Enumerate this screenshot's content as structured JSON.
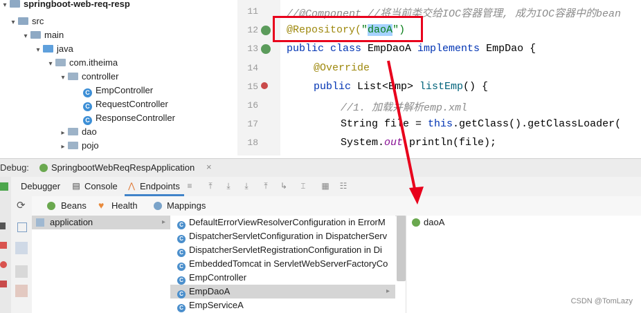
{
  "project_tree": {
    "root": "springboot-web-req-resp",
    "items": [
      {
        "label": "src"
      },
      {
        "label": "main"
      },
      {
        "label": "java"
      },
      {
        "label": "com.itheima"
      },
      {
        "label": "controller"
      },
      {
        "label": "EmpController"
      },
      {
        "label": "RequestController"
      },
      {
        "label": "ResponseController"
      },
      {
        "label": "dao"
      },
      {
        "label": "pojo"
      }
    ]
  },
  "editor": {
    "line_numbers": [
      "11",
      "12",
      "13",
      "14",
      "15",
      "16",
      "17",
      "18"
    ],
    "lines": {
      "l11": "//@Component //将当前类交给IOC容器管理, 成为IOC容器中的bean",
      "l12_ann": "@Repository(",
      "l12_q1": "\"",
      "l12_sel": "daoA",
      "l12_q2": "\")",
      "l13_kw1": "public class ",
      "l13_name": "EmpDaoA ",
      "l13_kw2": "implements ",
      "l13_iface": "EmpDao {",
      "l14": "@Override",
      "l15_kw": "public ",
      "l15_type": "List<Emp> ",
      "l15_fn": "listEmp",
      "l15_rest": "() {",
      "l16": "//1. 加载并解析emp.xml",
      "l17_a": "String file = ",
      "l17_kw": "this",
      "l17_b": ".getClass().getClassLoader(",
      "l18_a": "System.",
      "l18_fld": "out",
      "l18_b": ".println(file);"
    }
  },
  "debug": {
    "label": "Debug:",
    "session_tab": "SpringbootWebReqRespApplication",
    "close": "×",
    "tabs": [
      "Debugger",
      "Console",
      "Endpoints"
    ],
    "subtabs": [
      "Beans",
      "Health",
      "Mappings"
    ]
  },
  "beans": {
    "context": "application",
    "list": [
      "DefaultErrorViewResolverConfiguration in ErrorM",
      "DispatcherServletConfiguration in DispatcherServ",
      "DispatcherServletRegistrationConfiguration in Di",
      "EmbeddedTomcat in ServletWebServerFactoryCo",
      "EmpController",
      "EmpDaoA",
      "EmpServiceA"
    ],
    "selected_index": 5,
    "detail": "daoA"
  },
  "watermark": "CSDN @TomLazy",
  "colors": {
    "highlight_box": "#e8001c",
    "selection": "#d5d5d5",
    "arrow": "#e8001c"
  }
}
